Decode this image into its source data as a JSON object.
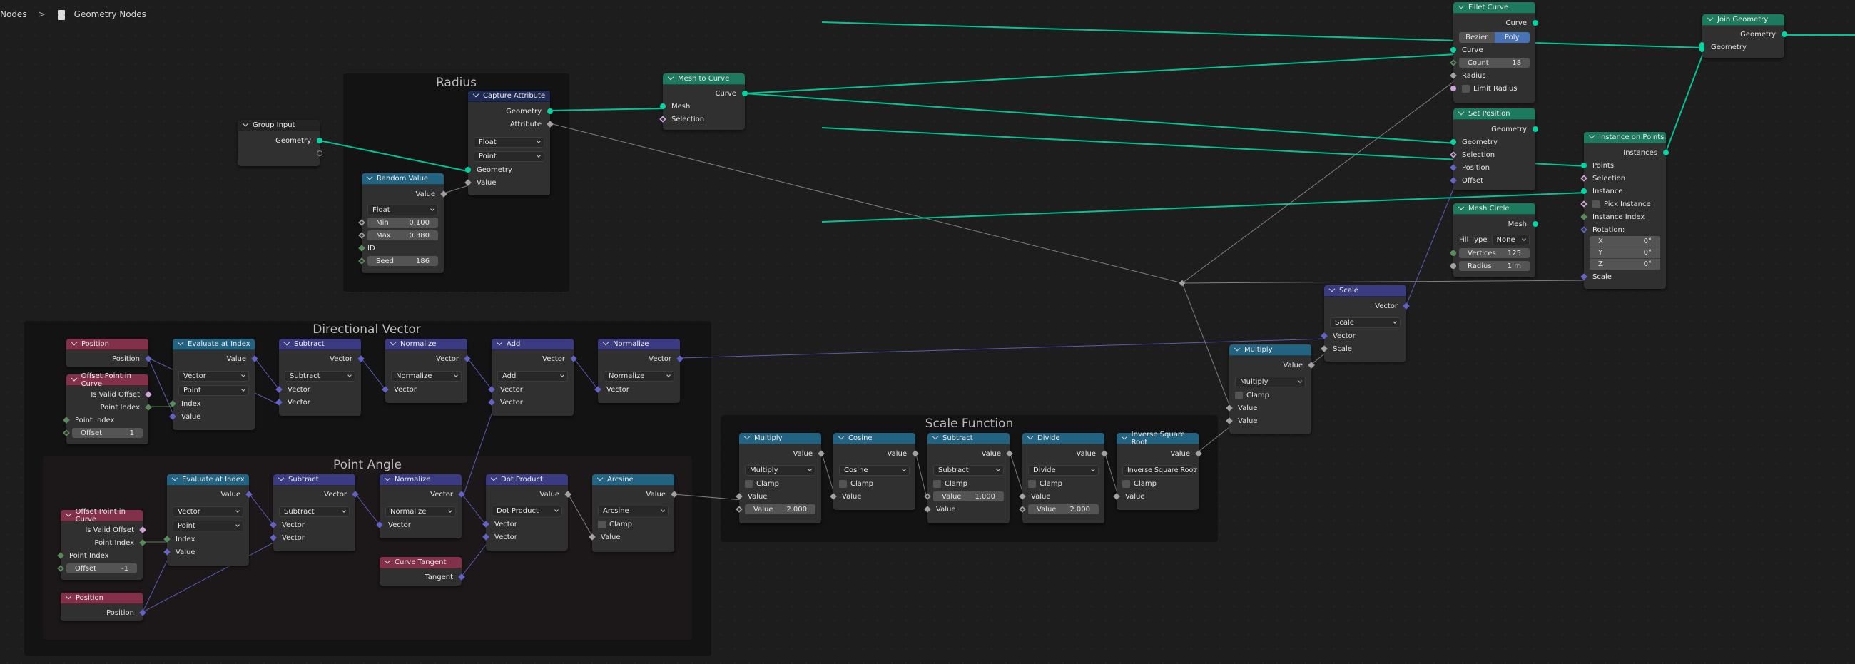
{
  "breadcrumb": {
    "parent": "Nodes",
    "current": "Geometry Nodes",
    "icon": "node-tree-icon"
  },
  "frames": {
    "radius": "Radius",
    "directional": "Directional Vector",
    "point_angle": "Point Angle",
    "scale_function": "Scale Function"
  },
  "nodes": {
    "group_input": {
      "title": "Group Input",
      "out_geometry": "Geometry"
    },
    "random_value": {
      "title": "Random Value",
      "out_value": "Value",
      "type": "Float",
      "min_label": "Min",
      "min": "0.100",
      "max_label": "Max",
      "max": "0.380",
      "id": "ID",
      "seed_label": "Seed",
      "seed": "186"
    },
    "capture_attribute": {
      "title": "Capture Attribute",
      "out_geometry": "Geometry",
      "out_attribute": "Attribute",
      "type": "Float",
      "domain": "Point",
      "in_geometry": "Geometry",
      "in_value": "Value"
    },
    "mesh_to_curve": {
      "title": "Mesh to Curve",
      "out_curve": "Curve",
      "in_mesh": "Mesh",
      "in_selection": "Selection"
    },
    "fillet_curve": {
      "title": "Fillet Curve",
      "out_curve": "Curve",
      "mode_bezier": "Bezier",
      "mode_poly": "Poly",
      "mode_selected": "Poly",
      "in_curve": "Curve",
      "count_label": "Count",
      "count": "18",
      "in_radius": "Radius",
      "limit_radius": "Limit Radius"
    },
    "set_position": {
      "title": "Set Position",
      "out_geometry": "Geometry",
      "in_geometry": "Geometry",
      "in_selection": "Selection",
      "in_position": "Position",
      "in_offset": "Offset"
    },
    "mesh_circle": {
      "title": "Mesh Circle",
      "out_mesh": "Mesh",
      "fill_label": "Fill Type",
      "fill_type": "None",
      "vertices_label": "Vertices",
      "vertices": "125",
      "radius_label": "Radius",
      "radius": "1 m"
    },
    "instance_on_points": {
      "title": "Instance on Points",
      "out_instances": "Instances",
      "in_points": "Points",
      "in_selection": "Selection",
      "in_instance": "Instance",
      "pick_instance": "Pick Instance",
      "instance_index": "Instance Index",
      "rotation": "Rotation:",
      "rx_label": "X",
      "rx": "0°",
      "ry_label": "Y",
      "ry": "0°",
      "rz_label": "Z",
      "rz": "0°",
      "in_scale": "Scale"
    },
    "join_geometry": {
      "title": "Join Geometry",
      "out_geometry": "Geometry",
      "in_geometry": "Geometry"
    },
    "scale": {
      "title": "Scale",
      "out_vector": "Vector",
      "op": "Scale",
      "in_vector": "Vector",
      "in_scale": "Scale"
    },
    "multiply_main": {
      "title": "Multiply",
      "out_value": "Value",
      "op": "Multiply",
      "clamp": "Clamp",
      "in_a": "Value",
      "in_b": "Value"
    },
    "dv_position": {
      "title": "Position",
      "out": "Position"
    },
    "dv_offset": {
      "title": "Offset Point in Curve",
      "is_valid": "Is Valid Offset",
      "out_index": "Point Index",
      "in_index": "Point Index",
      "offset_label": "Offset",
      "offset": "1"
    },
    "dv_eval": {
      "title": "Evaluate at Index",
      "out_value": "Value",
      "type": "Vector",
      "domain": "Point",
      "in_index": "Index",
      "in_value": "Value"
    },
    "dv_subtract": {
      "title": "Subtract",
      "out": "Vector",
      "op": "Subtract",
      "in_a": "Vector",
      "in_b": "Vector"
    },
    "dv_normalize1": {
      "title": "Normalize",
      "out": "Vector",
      "op": "Normalize",
      "in_a": "Vector"
    },
    "dv_add": {
      "title": "Add",
      "out": "Vector",
      "op": "Add",
      "in_a": "Vector",
      "in_b": "Vector"
    },
    "dv_normalize2": {
      "title": "Normalize",
      "out": "Vector",
      "op": "Normalize",
      "in_a": "Vector"
    },
    "pa_offset": {
      "title": "Offset Point in Curve",
      "is_valid": "Is Valid Offset",
      "out_index": "Point Index",
      "in_index": "Point Index",
      "offset_label": "Offset",
      "offset": "-1"
    },
    "pa_position": {
      "title": "Position",
      "out": "Position"
    },
    "pa_eval": {
      "title": "Evaluate at Index",
      "out_value": "Value",
      "type": "Vector",
      "domain": "Point",
      "in_index": "Index",
      "in_value": "Value"
    },
    "pa_subtract": {
      "title": "Subtract",
      "out": "Vector",
      "op": "Subtract",
      "in_a": "Vector",
      "in_b": "Vector"
    },
    "pa_normalize": {
      "title": "Normalize",
      "out": "Vector",
      "op": "Normalize",
      "in_a": "Vector"
    },
    "pa_tangent": {
      "title": "Curve Tangent",
      "out": "Tangent"
    },
    "pa_dot": {
      "title": "Dot Product",
      "out": "Value",
      "op": "Dot Product",
      "in_a": "Vector",
      "in_b": "Vector"
    },
    "pa_arcsine": {
      "title": "Arcsine",
      "out": "Value",
      "op": "Arcsine",
      "clamp": "Clamp",
      "in_a": "Value"
    },
    "sf_multiply": {
      "title": "Multiply",
      "out": "Value",
      "op": "Multiply",
      "clamp": "Clamp",
      "in_a": "Value",
      "val_label": "Value",
      "val": "2.000"
    },
    "sf_cosine": {
      "title": "Cosine",
      "out": "Value",
      "op": "Cosine",
      "clamp": "Clamp",
      "in_a": "Value"
    },
    "sf_subtract": {
      "title": "Subtract",
      "out": "Value",
      "op": "Subtract",
      "clamp": "Clamp",
      "val_label": "Value",
      "val": "1.000",
      "in_b": "Value"
    },
    "sf_divide": {
      "title": "Divide",
      "out": "Value",
      "op": "Divide",
      "clamp": "Clamp",
      "in_a": "Value",
      "val_label": "Value",
      "val": "2.000"
    },
    "sf_isqrt": {
      "title": "Inverse Square Root",
      "out": "Value",
      "op": "Inverse Square Root",
      "clamp": "Clamp",
      "in_a": "Value"
    }
  },
  "colors": {
    "geometry": "#00d6a3",
    "vector": "#6363c7",
    "float": "#a1a1a1",
    "integer": "#598c5c",
    "boolean": "#cca6d6",
    "geometry_header": "#1e7a5e",
    "converter_header": "#226382",
    "vector_header": "#3b3b82",
    "input_header": "#83314a",
    "attribute_header": "#1f2a54",
    "selected_button": "#4772b3"
  }
}
